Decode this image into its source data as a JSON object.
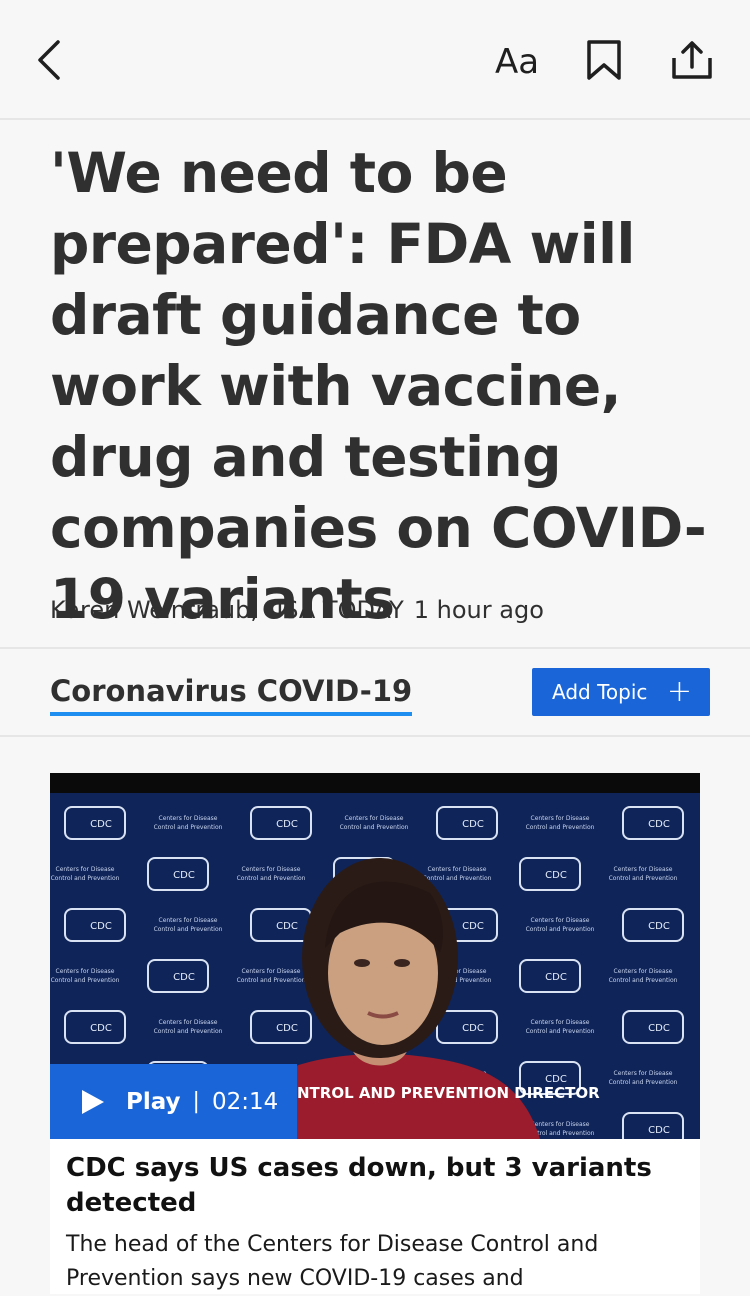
{
  "toolbar": {
    "back_icon": "chevron-left-icon",
    "font_size_label": "Aa",
    "bookmark_icon": "bookmark-icon",
    "share_icon": "share-icon"
  },
  "article": {
    "headline": "'We need to be prepared': FDA will draft guidance to work with vaccine, drug and testing companies on COVID-19 variants",
    "author": "Karen Weintraub, USA TODAY",
    "published": "1 hour ago"
  },
  "topic": {
    "name": "Coronavirus COVID-19",
    "add_label": "Add Topic",
    "add_icon": "plus-icon"
  },
  "video": {
    "backdrop_logo": "CDC",
    "backdrop_text_line1": "Centers for Disease",
    "backdrop_text_line2": "Control and Prevention",
    "lower_third": "NTROL AND PREVENTION DIRECTOR",
    "play_label": "Play",
    "separator": "|",
    "duration": "02:14",
    "title": "CDC says US cases down, but 3 variants detected",
    "description": "The head of the Centers for Disease Control and Prevention says new COVID-19 cases and"
  },
  "colors": {
    "accent": "#1a66d8",
    "topic_underline": "#1e8ff0",
    "text": "#303030",
    "background": "#f7f7f7"
  }
}
